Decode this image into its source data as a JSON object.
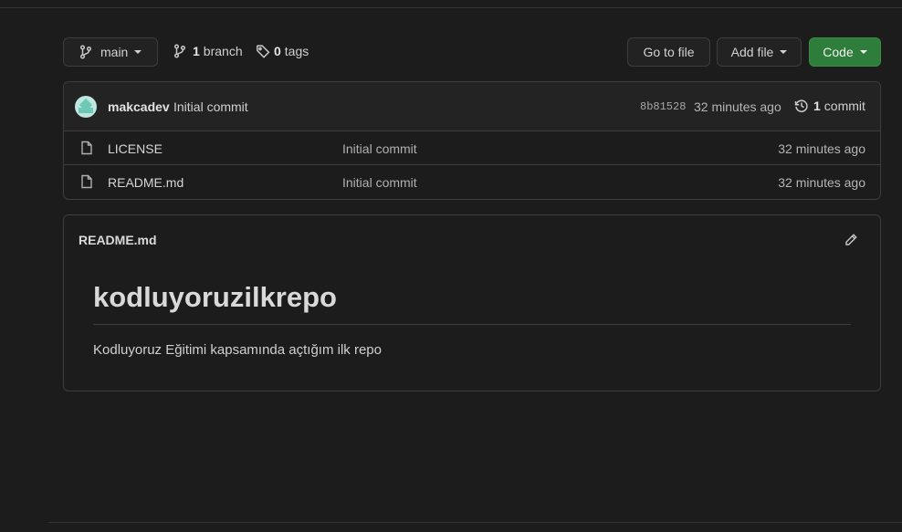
{
  "toolbar": {
    "branch_selector": "main",
    "branch_count": "1",
    "branch_label": "branch",
    "tag_count": "0",
    "tag_label": "tags",
    "goto_file": "Go to file",
    "add_file": "Add file",
    "code": "Code"
  },
  "latest_commit": {
    "author": "makcadev",
    "message": "Initial commit",
    "sha": "8b81528",
    "time": "32 minutes ago",
    "commit_count": "1",
    "commit_label": "commit"
  },
  "files": [
    {
      "name": "LICENSE",
      "commit": "Initial commit",
      "time": "32 minutes ago"
    },
    {
      "name": "README.md",
      "commit": "Initial commit",
      "time": "32 minutes ago"
    }
  ],
  "readme": {
    "filename": "README.md",
    "heading": "kodluyoruzilkrepo",
    "paragraph": "Kodluyoruz Eğitimi kapsamında açtığım ilk repo"
  },
  "colors": {
    "background": "#1c1c1c",
    "code_button": "#2f7d3a",
    "border": "#3d3d3d"
  },
  "icons": [
    "branch-icon",
    "tag-icon",
    "history-icon",
    "file-icon",
    "pencil-icon"
  ]
}
